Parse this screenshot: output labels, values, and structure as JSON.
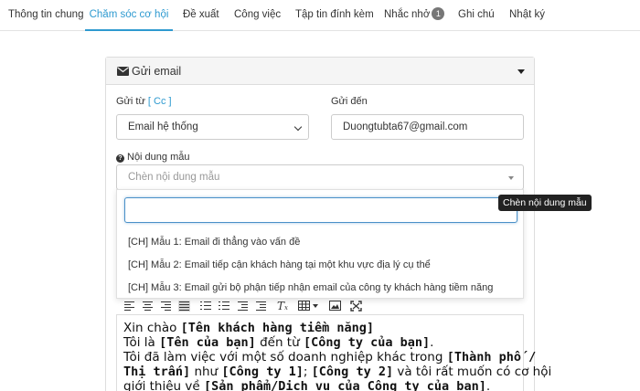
{
  "tabs": [
    {
      "label": "Thông tin chung"
    },
    {
      "label": "Chăm sóc cơ hội"
    },
    {
      "label": "Đề xuất"
    },
    {
      "label": "Công việc"
    },
    {
      "label": "Tập tin đính kèm"
    },
    {
      "label": "Nhắc nhở",
      "badge": "1"
    },
    {
      "label": "Ghi chú"
    },
    {
      "label": "Nhật ký"
    }
  ],
  "active_tab": "Chăm sóc cơ hội",
  "panel": {
    "title": "Gửi email",
    "title_icon": "envelope-icon"
  },
  "form": {
    "from_label": "Gửi từ",
    "cc_label": "[ Cc ]",
    "from_value": "Email hệ thống",
    "to_label": "Gửi đến",
    "to_value": "Duongtubta67@gmail.com",
    "template_label": "Nội dung mẫu",
    "template_placeholder": "Chèn nội dung mẫu"
  },
  "dropdown": {
    "search_value": "",
    "options": [
      "[CH] Mẫu 1: Email đi thẳng vào vấn đề",
      "[CH] Mẫu 2: Email tiếp cận khách hàng tại một khu vực địa lý cụ thể",
      "[CH] Mẫu 3: Email gửi bộ phận tiếp nhận email của công ty khách hàng tiềm năng"
    ]
  },
  "tooltip": "Chèn nội dung mẫu",
  "toolbar_icons": [
    "align-left-icon",
    "align-center-icon",
    "align-right-icon",
    "align-justify-icon",
    "ordered-list-icon",
    "unordered-list-icon",
    "outdent-icon",
    "indent-icon",
    "clear-format-icon",
    "table-icon",
    "image-icon",
    "fullscreen-icon"
  ],
  "editor": {
    "l1a": "Xin chào ",
    "l1b": "[Tên khách hàng tiềm năng]",
    "l2a": "Tôi là ",
    "l2b": "[Tên của bạn]",
    "l2c": " đến từ ",
    "l2d": "[Công ty của bạn]",
    "l2e": ".",
    "l3a": "Tôi đã làm việc với một số doanh nghiệp khác trong ",
    "l3b": "[Thành phố /",
    "l4a": "Thị trấn]",
    "l4b": " như ",
    "l4c": "[Công ty 1]",
    "l4d": "; ",
    "l4e": "[Công ty 2]",
    "l4f": " và tôi rất muốn có cơ hội",
    "l5a": "giới thiệu về ",
    "l5b": "[Sản phẩm/Dịch vụ của Công ty của bạn]",
    "l5c": "."
  }
}
